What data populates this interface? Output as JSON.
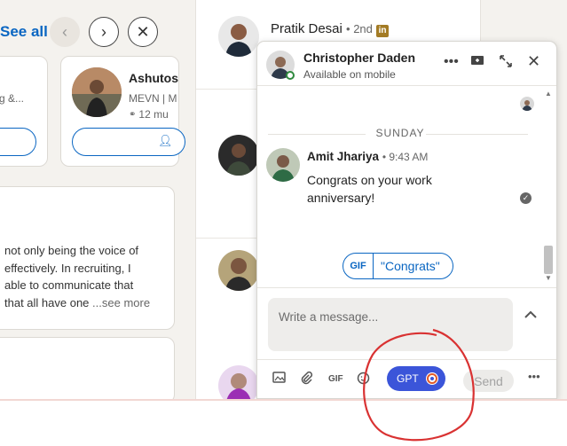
{
  "carousel": {
    "see_all": "See all",
    "prev_icon": "‹",
    "next_icon": "›",
    "close_icon": "✕",
    "card1": {
      "line1": "g &..."
    },
    "card2": {
      "name": "Ashutos",
      "headline": "MEVN | M",
      "mutual": "12 mu"
    }
  },
  "post": {
    "text_lines": [
      "not only being the voice of",
      "effectively. In recruiting, I",
      "able to communicate that",
      "that all have one "
    ],
    "see_more": "...see more"
  },
  "feed": {
    "person1_name": "Pratik Desai",
    "person1_degree": "• 2nd"
  },
  "chat": {
    "name": "Christopher Daden",
    "status": "Available on mobile",
    "day_label": "SUNDAY",
    "message": {
      "sender": "Amit Jhariya",
      "time": "• 9:43 AM",
      "body": "Congrats on your work anniversary!"
    },
    "suggestion_gif": "GIF",
    "suggestion_text": "\"Congrats\"",
    "placeholder": "Write a message...",
    "gif_label": "GIF",
    "gpt_label": "GPT",
    "send_label": "Send"
  },
  "colors": {
    "accent": "#0a66c2",
    "gpt": "#3b55d9",
    "annotation": "#d93232"
  }
}
